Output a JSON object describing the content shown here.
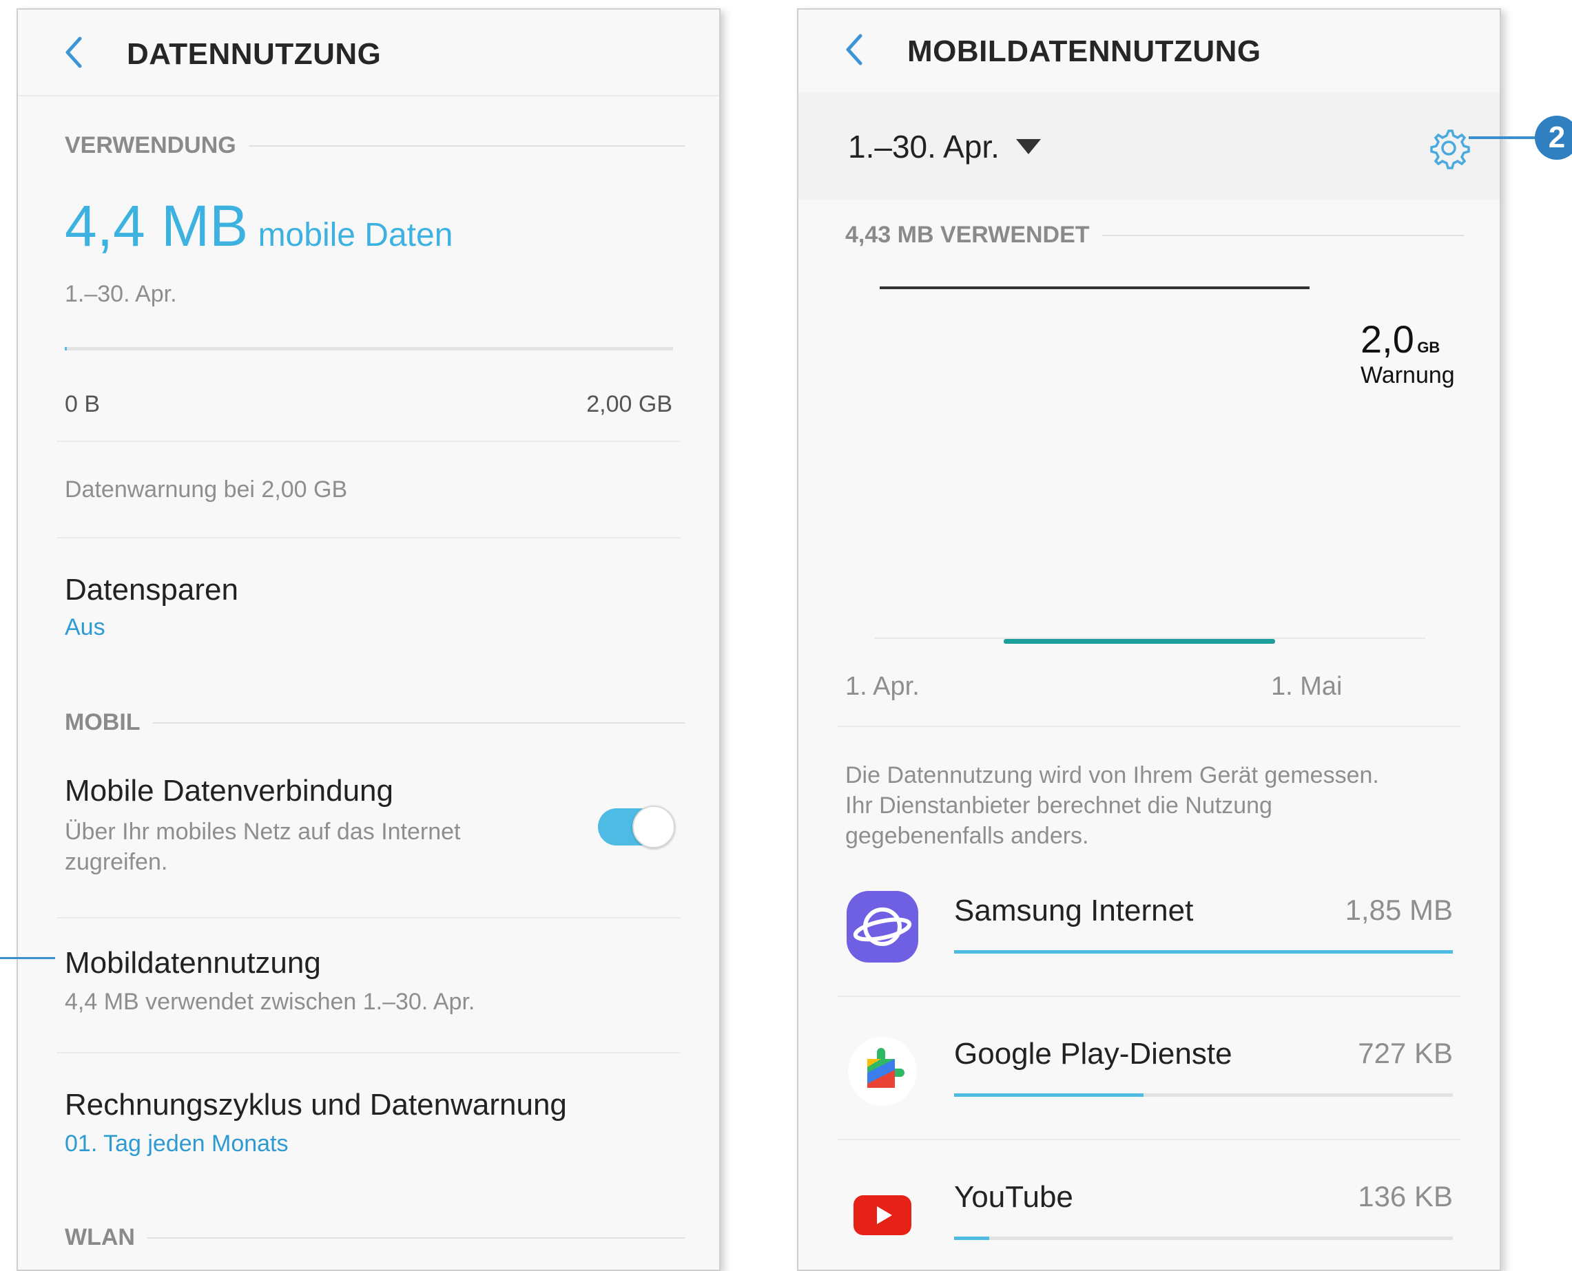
{
  "left": {
    "title": "DATENNUTZUNG",
    "section_usage": "VERWENDUNG",
    "usage_amount": "4,4 MB",
    "usage_unit": "mobile Daten",
    "period": "1.–30. Apr.",
    "scale_min": "0 B",
    "scale_max": "2,00 GB",
    "usage_fraction": 0.002,
    "warning_text": "Datenwarnung bei 2,00 GB",
    "datensparen": {
      "title": "Datensparen",
      "value": "Aus"
    },
    "section_mobil": "MOBIL",
    "mobile_connection": {
      "title": "Mobile Datenverbindung",
      "desc1": "Über Ihr mobiles Netz auf das Internet",
      "desc2": "zugreifen.",
      "enabled": true
    },
    "mobile_usage": {
      "title": "Mobildatennutzung",
      "desc": "4,4 MB verwendet zwischen 1.–30. Apr."
    },
    "billing": {
      "title": "Rechnungszyklus und Datenwarnung",
      "value": "01. Tag jeden Monats"
    },
    "section_wlan": "WLAN"
  },
  "right": {
    "title": "MOBILDATENNUTZUNG",
    "period_select": "1.–30. Apr.",
    "used_label": "4,43 MB VERWENDET",
    "chart": {
      "warning_value": "2,0",
      "warning_unit": "GB",
      "warning_label": "Warnung",
      "x_start": "1. Apr.",
      "x_end": "1. Mai"
    },
    "note1": "Die Datennutzung wird von Ihrem Gerät gemessen.",
    "note2": "Ihr Dienstanbieter berechnet die Nutzung",
    "note3": "gegebenenfalls anders.",
    "apps": [
      {
        "name": "Samsung Internet",
        "size": "1,85 MB",
        "icon": "samsung-internet-icon",
        "fraction": 1.0
      },
      {
        "name": "Google Play-Dienste",
        "size": "727 KB",
        "icon": "google-play-services-icon",
        "fraction": 0.38
      },
      {
        "name": "YouTube",
        "size": "136 KB",
        "icon": "youtube-icon",
        "fraction": 0.07
      }
    ]
  },
  "callouts": {
    "gear": "2"
  },
  "colors": {
    "accent": "#3db2e0",
    "link": "#2d9bd2",
    "chart_line": "#1c9e9a",
    "callout": "#2f7fc1"
  }
}
